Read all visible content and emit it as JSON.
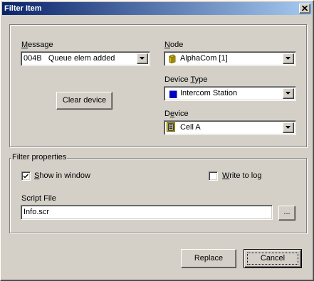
{
  "window": {
    "title": "Filter Item"
  },
  "top_group": {
    "message": {
      "label_prefix": "",
      "label_hot": "M",
      "label_rest": "essage",
      "value": "004B   Queue elem added"
    },
    "node": {
      "label_hot": "N",
      "label_rest": "ode",
      "value": "AlphaCom [1]",
      "icon": "cube-icon",
      "icon_color": "#c8a800"
    },
    "device_type": {
      "label_pre": "Device ",
      "label_hot": "T",
      "label_rest": "ype",
      "value": "Intercom Station",
      "icon": "square-icon",
      "icon_color": "#0000c0"
    },
    "device": {
      "label_pre": "D",
      "label_hot": "e",
      "label_rest": "vice",
      "value": "Cell A",
      "icon": "intercom-device-icon"
    },
    "clear_device_label": "Clear device"
  },
  "filter_group": {
    "title": "Filter properties",
    "show_in_window": {
      "label_hot": "S",
      "label_rest": "how in window",
      "checked": true
    },
    "write_to_log": {
      "label_hot": "W",
      "label_rest": "rite to log",
      "checked": false
    },
    "script_file": {
      "label": "Script File",
      "value": "Info.scr"
    },
    "browse_label": "..."
  },
  "buttons": {
    "replace": "Replace",
    "cancel": "Cancel"
  }
}
